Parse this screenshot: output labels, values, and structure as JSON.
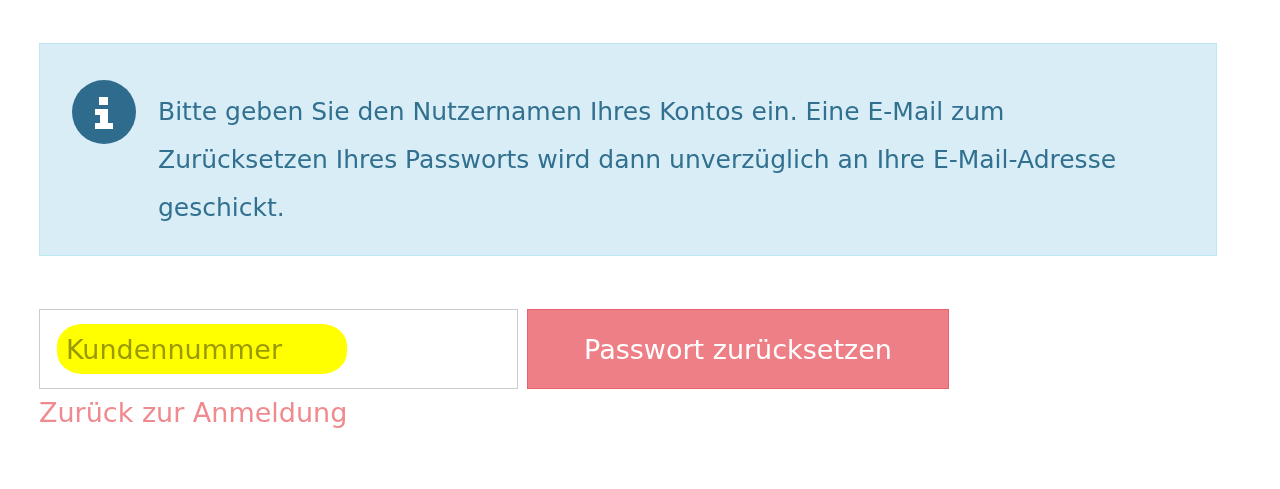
{
  "notice": {
    "kind": "info",
    "text": "Bitte geben Sie den Nutzernamen Ihres Kontos ein. Eine E-Mail zum Zurücksetzen Ihres Passworts wird dann unverzüglich an Ihre E-Mail-Adresse geschickt."
  },
  "field": {
    "placeholder": "Kundennummer",
    "highlighted": true
  },
  "submit_button": {
    "label": "Passwort zurücksetzen"
  },
  "back_link": {
    "label": "Zurück zur Anmeldung"
  }
}
